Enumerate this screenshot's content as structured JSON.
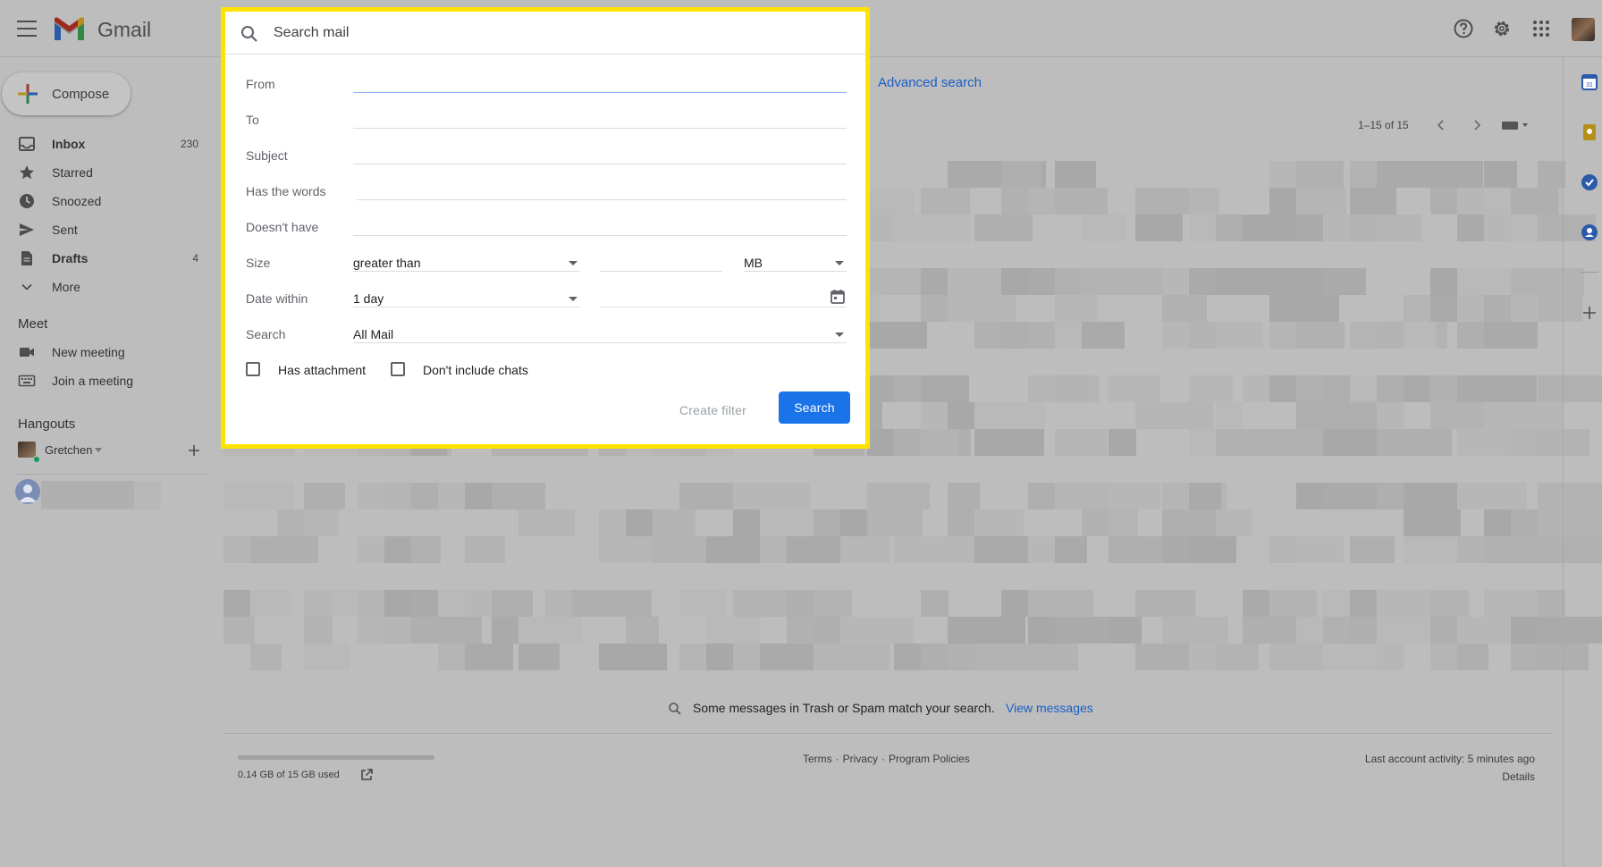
{
  "app": {
    "name": "Gmail"
  },
  "header": {
    "icons": [
      "menu-icon",
      "help-icon",
      "settings-icon",
      "apps-icon",
      "account-avatar"
    ]
  },
  "sidebar": {
    "compose_label": "Compose",
    "items": [
      {
        "label": "Inbox",
        "count": "230",
        "icon": "inbox-icon",
        "bold": true
      },
      {
        "label": "Starred",
        "count": "",
        "icon": "star-icon",
        "bold": false
      },
      {
        "label": "Snoozed",
        "count": "",
        "icon": "clock-icon",
        "bold": false
      },
      {
        "label": "Sent",
        "count": "",
        "icon": "send-icon",
        "bold": false
      },
      {
        "label": "Drafts",
        "count": "4",
        "icon": "draft-icon",
        "bold": true
      },
      {
        "label": "More",
        "count": "",
        "icon": "chevron-down-icon",
        "bold": false
      }
    ],
    "meet": {
      "title": "Meet",
      "items": [
        {
          "label": "New meeting",
          "icon": "video-icon"
        },
        {
          "label": "Join a meeting",
          "icon": "keyboard-icon"
        }
      ]
    },
    "hangouts": {
      "title": "Hangouts",
      "user": "Gretchen"
    }
  },
  "main": {
    "advanced_search_link": "Advanced search",
    "pagination": "1–15 of 15",
    "notice_text": "Some messages in Trash or Spam match your search.",
    "notice_link": "View messages",
    "footer": {
      "storage": "0.14 GB of 15 GB used",
      "links": [
        "Terms",
        "Privacy",
        "Program Policies"
      ],
      "separator": "·",
      "activity": "Last account activity: 5 minutes ago",
      "details": "Details"
    }
  },
  "advanced_search": {
    "search_placeholder": "Search mail",
    "fields": {
      "from": "From",
      "to": "To",
      "subject": "Subject",
      "has_words": "Has the words",
      "doesnt_have": "Doesn't have",
      "size": "Size",
      "date_within": "Date within",
      "search": "Search"
    },
    "size_operator": "greater than",
    "size_unit": "MB",
    "date_within_value": "1 day",
    "search_scope": "All Mail",
    "checkboxes": {
      "has_attachment": "Has attachment",
      "dont_include_chats": "Don't include chats"
    },
    "buttons": {
      "create_filter": "Create filter",
      "search": "Search"
    },
    "highlight_color": "#ffe300",
    "accent_color": "#1a73e8"
  }
}
